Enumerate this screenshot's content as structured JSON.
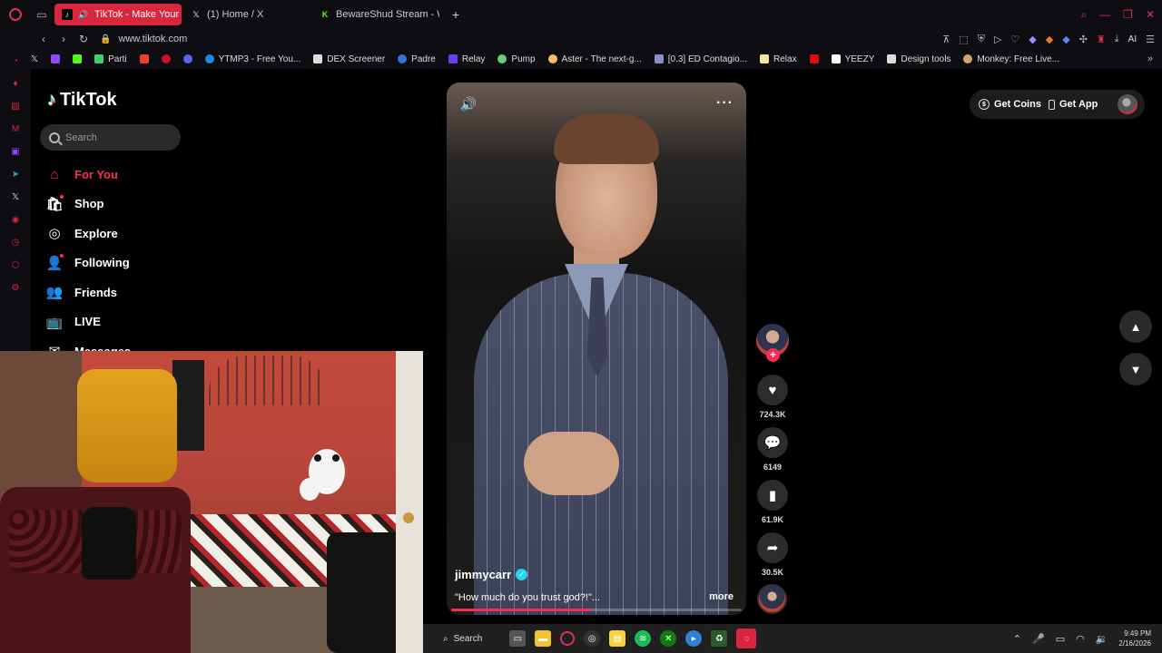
{
  "browser": {
    "tabs": [
      {
        "label": "TikTok - Make Your Da",
        "active": true,
        "favicon": "tiktok-icon"
      },
      {
        "label": "(1) Home / X",
        "active": false,
        "favicon": "x-icon"
      },
      {
        "label": "BewareShud Stream - Wa",
        "active": false,
        "favicon": "kick-icon"
      }
    ],
    "new_tab": "+",
    "url": "www.tiktok.com",
    "ai_label": "AI",
    "bookmarks": [
      {
        "label": "Parti",
        "color": "#3dd16b"
      },
      {
        "label": "YTMP3 - Free You...",
        "color": "#1e88e5"
      },
      {
        "label": "DEX Screener",
        "color": "#dddddd"
      },
      {
        "label": "Padre",
        "color": "#3b6fd8"
      },
      {
        "label": "Relay",
        "color": "#6a3df0"
      },
      {
        "label": "Pump",
        "color": "#66d17a"
      },
      {
        "label": "Aster - The next-g...",
        "color": "#f3c25a"
      },
      {
        "label": "[0.3] ED Contagio...",
        "color": "#8a8fcf"
      },
      {
        "label": "Relax",
        "color": "#f3e5a0"
      },
      {
        "label": "YEEZY",
        "color": "#ffffff"
      },
      {
        "label": "Design tools",
        "color": "#dddddd"
      },
      {
        "label": "Monkey: Free Live...",
        "color": "#d3a86a"
      }
    ]
  },
  "tiktok": {
    "logo": "TikTok",
    "search_placeholder": "Search",
    "nav": [
      {
        "label": "For You",
        "icon": "home-icon",
        "active": true
      },
      {
        "label": "Shop",
        "icon": "shop-icon",
        "active": false
      },
      {
        "label": "Explore",
        "icon": "compass-icon",
        "active": false
      },
      {
        "label": "Following",
        "icon": "following-icon",
        "active": false
      },
      {
        "label": "Friends",
        "icon": "friends-icon",
        "active": false
      },
      {
        "label": "LIVE",
        "icon": "live-icon",
        "active": false
      },
      {
        "label": "Messages",
        "icon": "messages-icon",
        "active": false
      }
    ],
    "get_coins": "Get Coins",
    "get_app": "Get App",
    "video": {
      "username": "jimmycarr",
      "caption": "\"How much do you trust god?!\"...",
      "more": "more",
      "progress": 0.48
    },
    "actions": {
      "likes": "724.3K",
      "comments": "6149",
      "saves": "61.9K",
      "shares": "30.5K"
    }
  },
  "taskbar": {
    "search": "Search",
    "time": "9:49 PM",
    "date": "2/16/2026"
  },
  "colors": {
    "accent": "#fe2c55",
    "opera_red": "#d7263d"
  }
}
